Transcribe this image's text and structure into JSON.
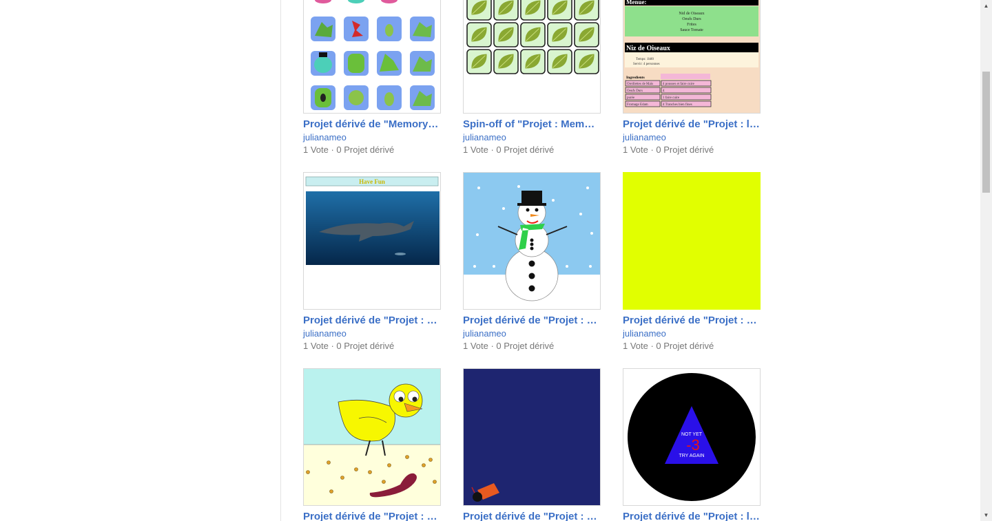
{
  "cards": [
    {
      "title": "Projet dérivé de \"Memory …",
      "author": "julianameo",
      "stats": "1 Vote · 0 Projet dérivé",
      "thumb": "memory-grid"
    },
    {
      "title": "Spin-off of \"Projet : Memo…",
      "author": "julianameo",
      "stats": "1 Vote · 0 Projet dérivé",
      "thumb": "leaf-grid"
    },
    {
      "title": "Projet dérivé de \"Projet : l…",
      "author": "julianameo",
      "stats": "1 Vote · 0 Projet dérivé",
      "thumb": "recipe-page",
      "recipe": {
        "menu": "Menue:",
        "items": [
          "Nid de Oiseaux",
          "Oeufs Durs",
          "Frites",
          "Sauce Tomate"
        ],
        "heading": "Niz de Oiseaux",
        "info": [
          "Temps: 1h00",
          "Servir: 4 personnes"
        ],
        "col1": "Ingredients",
        "col2": "Quantité",
        "rows": [
          [
            "Oreillettes de Maïs",
            "4 pousses et faire cuire"
          ],
          [
            "Oeufs Durs",
            "4"
          ],
          [
            "purée",
            "1 faire cuire"
          ],
          [
            "Fromage Edam",
            "4 Tranches bien fines"
          ]
        ]
      }
    },
    {
      "title": "Projet dérivé de \"Projet : s…",
      "author": "julianameo",
      "stats": "1 Vote · 0 Projet dérivé",
      "thumb": "shark-page",
      "banner": "Have Fun"
    },
    {
      "title": "Projet dérivé de \"Projet : s…",
      "author": "julianameo",
      "stats": "1 Vote · 0 Projet dérivé",
      "thumb": "snowman"
    },
    {
      "title": "Projet dérivé de \"Projet : a…",
      "author": "julianameo",
      "stats": "1 Vote · 0 Projet dérivé",
      "thumb": "yellow-square"
    },
    {
      "title": "Projet dérivé de \"Projet : a…",
      "author": "",
      "stats": "",
      "thumb": "duck"
    },
    {
      "title": "Projet dérivé de \"Projet : é…",
      "author": "",
      "stats": "",
      "thumb": "cannon"
    },
    {
      "title": "Projet dérivé de \"Projet : l…",
      "author": "",
      "stats": "",
      "thumb": "circle-game",
      "game": {
        "line1": "NOT YET",
        "score": "-3",
        "line2": "TRY AGAIN"
      }
    }
  ],
  "colors": {
    "link": "#3b6fc6",
    "meta": "#777777",
    "yellow": "#e1ff00",
    "navy": "#1e2570"
  }
}
